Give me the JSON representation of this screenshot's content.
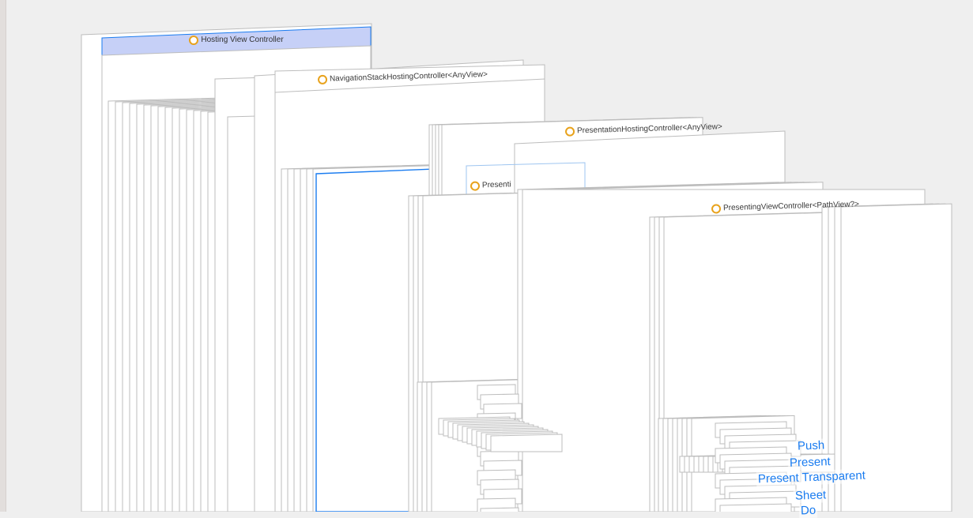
{
  "app": {
    "accent_color": "#1a7cf0",
    "selection_fill": "#c6d0f7",
    "icon_color": "#e8a21b"
  },
  "controllers": {
    "hosting": "Hosting View Controller",
    "navigation_stack": "NavigationStackHostingController<AnyView>",
    "presentation_hosting": "PresentationHostingController<AnyView>",
    "presentation_partial": "Presenti",
    "presenting": "PresentingViewController<PathView?>"
  },
  "buttons": {
    "push": "Push",
    "present": "Present",
    "present_transparent": "Present Transparent",
    "sheet": "Sheet",
    "partial": "Do"
  }
}
